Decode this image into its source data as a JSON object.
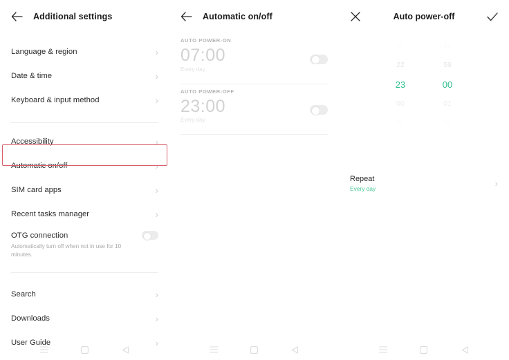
{
  "panels": {
    "left": {
      "header": {
        "back_icon": "arrow-left-icon",
        "title": "Additional settings"
      },
      "items": [
        {
          "label": "Language & region",
          "chevron": "›"
        },
        {
          "label": "Date & time",
          "chevron": "›"
        },
        {
          "label": "Keyboard & input method",
          "chevron": "›"
        },
        {
          "label": "Accessibility",
          "chevron": "›"
        },
        {
          "label": "Automatic on/off",
          "chevron": "›",
          "highlighted": true
        },
        {
          "label": "SIM card apps",
          "chevron": "›"
        },
        {
          "label": "Recent tasks manager",
          "chevron": "›"
        },
        {
          "label": "OTG connection",
          "sub": "Automatically turn off when not in use for 10 minutes.",
          "toggle": "off"
        },
        {
          "label": "Search",
          "chevron": "›"
        },
        {
          "label": "Downloads",
          "chevron": "›"
        },
        {
          "label": "User Guide",
          "chevron": "›"
        }
      ],
      "highlight_color": "#d9606a"
    },
    "middle": {
      "header": {
        "back_icon": "arrow-left-icon",
        "title": "Automatic on/off"
      },
      "sections": [
        {
          "caption": "AUTO POWER-ON",
          "time": "07:00",
          "repeat": "Every day",
          "toggle": "off"
        },
        {
          "caption": "AUTO POWER-OFF",
          "time": "23:00",
          "repeat": "Every day",
          "toggle": "off"
        }
      ]
    },
    "right": {
      "header": {
        "close_icon": "close-icon",
        "title": "Auto power-off",
        "confirm_icon": "check-icon"
      },
      "picker": {
        "hours": [
          "21",
          "22",
          "23",
          "00",
          "01"
        ],
        "minutes": [
          "58",
          "59",
          "00",
          "01",
          "02"
        ],
        "selected_index": 2,
        "selected_hour": "23",
        "selected_minute": "00",
        "accent_color": "#2fbf8d"
      },
      "repeat": {
        "label": "Repeat",
        "value": "Every day",
        "chevron": "›"
      }
    }
  },
  "navbar": {
    "menu_icon": "menu-icon",
    "home_icon": "home-square-icon",
    "back_icon": "back-triangle-icon"
  }
}
